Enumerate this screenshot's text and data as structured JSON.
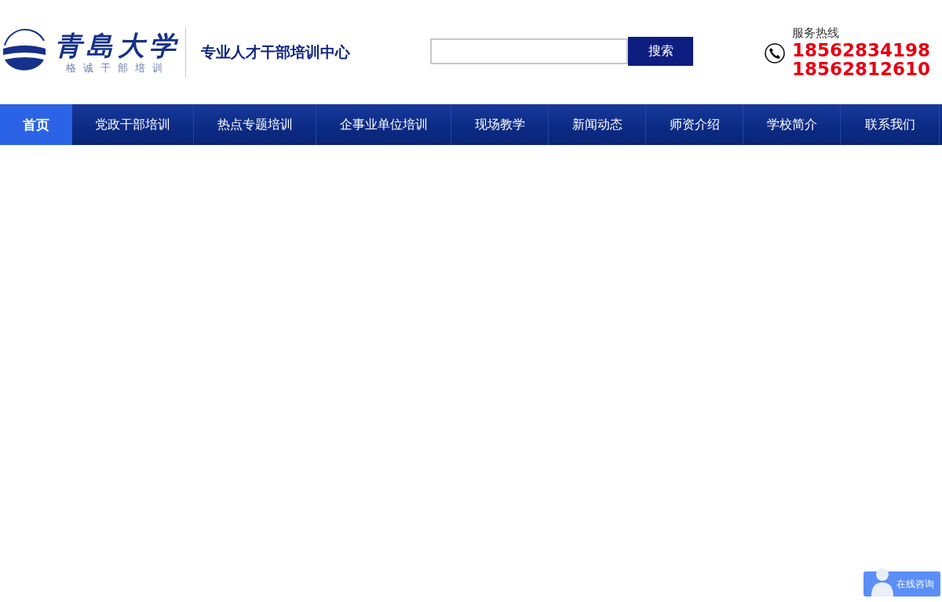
{
  "header": {
    "logo": {
      "name": "青島大学",
      "slogan": "格诚干部培训"
    },
    "center_title": "专业人才干部培训中心",
    "search": {
      "button": "搜索"
    },
    "hotline": {
      "label": "服务热线",
      "numbers": [
        "18562834198",
        "18562812610"
      ]
    }
  },
  "nav": [
    {
      "label": "首页",
      "selected": true
    },
    {
      "label": "党政干部培训",
      "selected": false
    },
    {
      "label": "热点专题培训",
      "selected": false
    },
    {
      "label": "企事业单位培训",
      "selected": false
    },
    {
      "label": "现场教学",
      "selected": false
    },
    {
      "label": "新闻动态",
      "selected": false
    },
    {
      "label": "师资介绍",
      "selected": false
    },
    {
      "label": "学校简介",
      "selected": false
    },
    {
      "label": "联系我们",
      "selected": false
    }
  ],
  "chat_button": {
    "label": "在线咨询"
  }
}
